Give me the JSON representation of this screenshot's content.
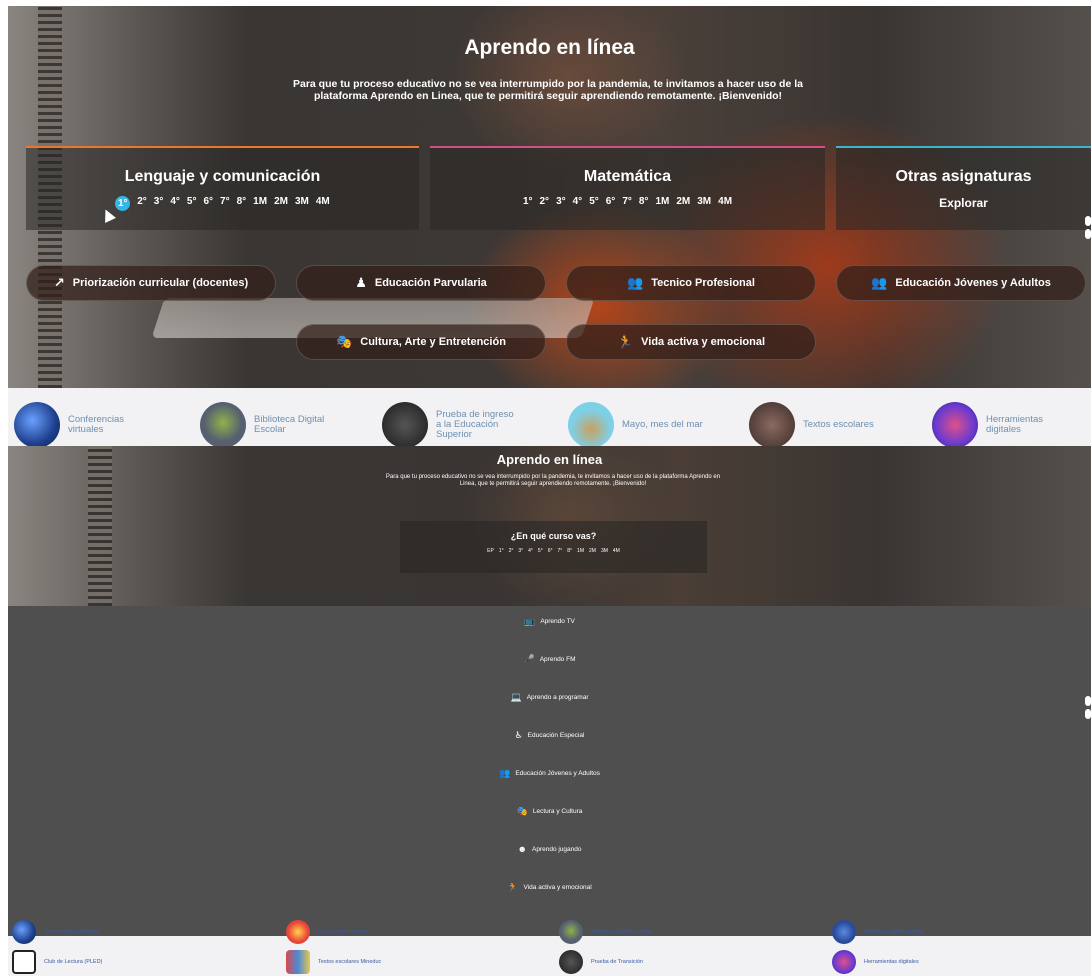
{
  "top": {
    "title": "Aprendo en línea",
    "subtitle": "Para que tu proceso educativo no se vea interrumpido por la pandemia, te invitamos a hacer uso de la plataforma Aprendo en Linea, que te permitirá seguir aprendiendo remotamente. ¡Bienvenido!",
    "subjects": {
      "lenguaje": {
        "title": "Lenguaje y comunicación",
        "grades": [
          "1°",
          "2°",
          "3°",
          "4°",
          "5°",
          "6°",
          "7°",
          "8°",
          "1M",
          "2M",
          "3M",
          "4M"
        ],
        "active_grade": "1°"
      },
      "matematica": {
        "title": "Matemática",
        "grades": [
          "1°",
          "2°",
          "3°",
          "4°",
          "5°",
          "6°",
          "7°",
          "8°",
          "1M",
          "2M",
          "3M",
          "4M"
        ]
      },
      "otras": {
        "title": "Otras asignaturas",
        "explore": "Explorar"
      }
    },
    "pills": [
      {
        "label": "Priorización curricular (docentes)",
        "icon": "external-link-icon"
      },
      {
        "label": "Educación Parvularia",
        "icon": "child-icon"
      },
      {
        "label": "Tecnico Profesional",
        "icon": "users-icon"
      },
      {
        "label": "Educación Jóvenes y Adultos",
        "icon": "users-icon"
      },
      {
        "label": "Cultura, Arte y Entretención",
        "icon": "theater-masks-icon"
      },
      {
        "label": "Vida activa y emocional",
        "icon": "running-icon"
      }
    ],
    "resources": [
      {
        "label": "Conferencias virtuales",
        "color": "#1d3f8c"
      },
      {
        "label": "Biblioteca Digital Escolar",
        "color": "#566070"
      },
      {
        "label": "Prueba de ingreso a la Educación Superior",
        "color": "#2a2a2a"
      },
      {
        "label": "Mayo, mes del mar",
        "color": "#7ed0e6"
      },
      {
        "label": "Textos escolares",
        "color": "#4a3a38"
      },
      {
        "label": "Herramientas digitales",
        "color": "#6a3ad0"
      }
    ]
  },
  "bottom": {
    "title": "Aprendo en línea",
    "subtitle": "Para que tu proceso educativo no se vea interrumpido por la pandemia, te invitamos a hacer uso de la plataforma Aprendo en Linea, que te permitirá seguir aprendiendo remotamente. ¡Bienvenido!",
    "course_question": "¿En qué curso vas?",
    "course_grades": [
      "EP",
      "1°",
      "2°",
      "3°",
      "4°",
      "5°",
      "6°",
      "7°",
      "8°",
      "1M",
      "2M",
      "3M",
      "4M"
    ],
    "menu": [
      {
        "label": "Aprendo TV",
        "icon": "tv-icon"
      },
      {
        "label": "Aprendo FM",
        "icon": "microphone-icon"
      },
      {
        "label": "Aprendo a programar",
        "icon": "laptop-icon"
      },
      {
        "label": "Educación Especial",
        "icon": "accessibility-icon"
      },
      {
        "label": "Educación Jóvenes y Adultos",
        "icon": "users-icon"
      },
      {
        "label": "Lectura y Cultura",
        "icon": "theater-masks-icon"
      },
      {
        "label": "Aprendo jugando",
        "icon": "smile-icon"
      },
      {
        "label": "Vida activa y emocional",
        "icon": "running-icon"
      }
    ],
    "resources": [
      {
        "label": "Conferencias virtuales",
        "color": "#1d3f8c"
      },
      {
        "label": "Leo y Sumo Primero",
        "color": "#e8433a"
      },
      {
        "label": "Biblioteca Digital Escolar",
        "color": "#566070"
      },
      {
        "label": "Biblioteca digital abierta",
        "color": "#2a4a9a"
      },
      {
        "label": "Club de Lectura (PLED)",
        "color": "#ffffff"
      },
      {
        "label": "Textos escolares Mineduc",
        "color": "#d84a4a"
      },
      {
        "label": "Prueba de Transición",
        "color": "#2a2a2a"
      },
      {
        "label": "Herramientas digitales",
        "color": "#6a3ad0"
      }
    ]
  }
}
